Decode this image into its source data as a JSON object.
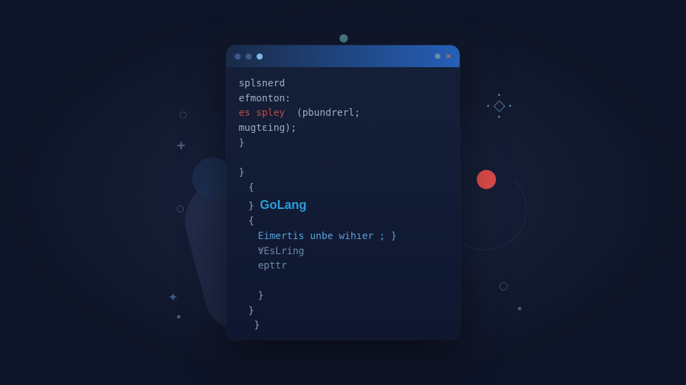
{
  "background": {
    "decorations": [
      "plus",
      "star",
      "diamond",
      "circles",
      "dots",
      "arc",
      "blob"
    ]
  },
  "window": {
    "controls": {
      "traffic_lights": 3,
      "close_label": "✕",
      "minimize_label": "•"
    }
  },
  "code": {
    "line1": "splsnerd",
    "line2": "efmonton:",
    "line3_kw": "es spley",
    "line3_rest": "  (pbundrerl;",
    "line4": "mugtɛing);",
    "brace_close1": "}",
    "brace_close2": "}",
    "brace_open1": "{",
    "brace_close3": "}",
    "golang": "GoLang",
    "brace_open2": "{",
    "line_eimertis": "Eimertis unbe wihıer ; }",
    "line_vesring": "∀EsLring",
    "line_epttr": "epttr",
    "brace_close4": "}",
    "brace_close5": "}",
    "brace_close6": " }"
  }
}
